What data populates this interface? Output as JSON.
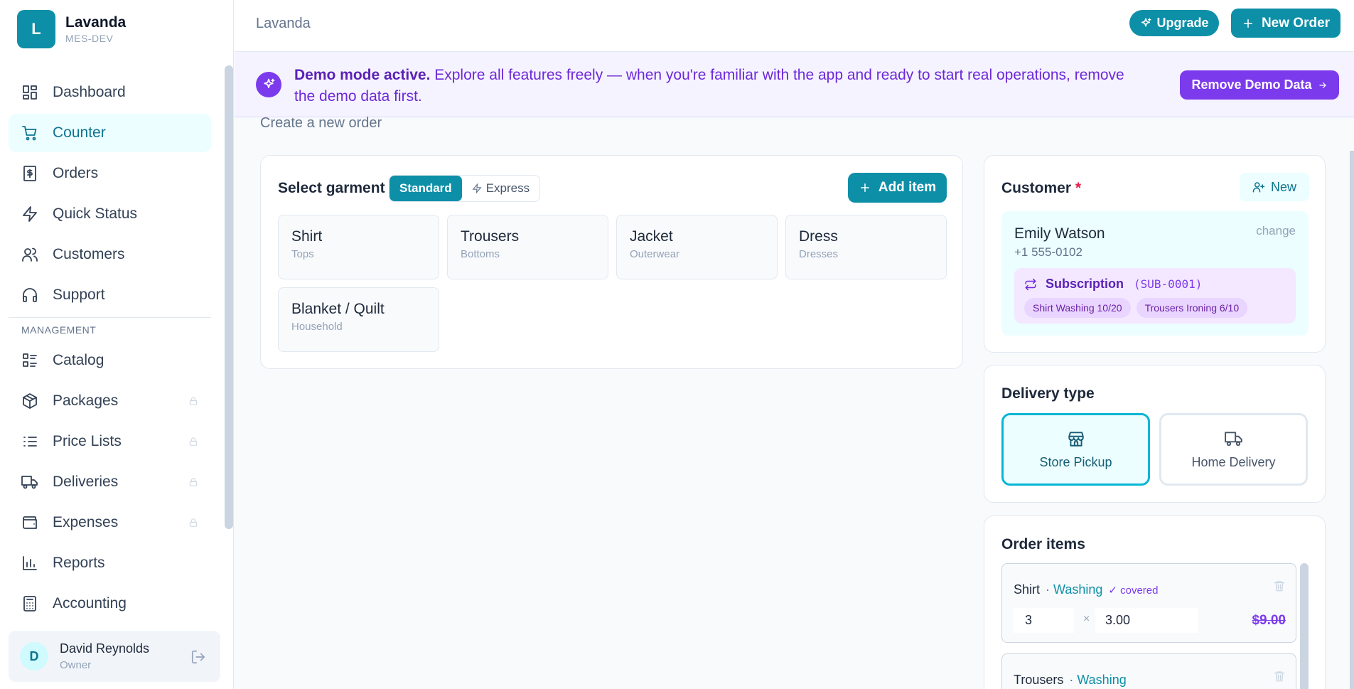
{
  "brand": {
    "initial": "L",
    "name": "Lavanda",
    "sub": "MES-DEV"
  },
  "nav": {
    "items": [
      {
        "label": "Dashboard"
      },
      {
        "label": "Counter"
      },
      {
        "label": "Orders"
      },
      {
        "label": "Quick Status"
      },
      {
        "label": "Customers"
      },
      {
        "label": "Support"
      }
    ],
    "section_label": "MANAGEMENT",
    "mgmt_items": [
      {
        "label": "Catalog"
      },
      {
        "label": "Packages"
      },
      {
        "label": "Price Lists"
      },
      {
        "label": "Deliveries"
      },
      {
        "label": "Expenses"
      },
      {
        "label": "Reports"
      },
      {
        "label": "Accounting"
      }
    ]
  },
  "user": {
    "initial": "D",
    "name": "David Reynolds",
    "role": "Owner"
  },
  "topbar": {
    "title": "Lavanda",
    "upgrade_label": "Upgrade",
    "new_order_label": "New Order"
  },
  "banner": {
    "bold": "Demo mode active.",
    "text": " Explore all features freely — when you're familiar with the app and ready to start real operations, remove the demo data first.",
    "button_label": "Remove Demo Data"
  },
  "page": {
    "subtitle": "Create a new order"
  },
  "garments": {
    "title": "Select garment",
    "mode_standard": "Standard",
    "mode_express": "Express",
    "add_label": "Add item",
    "items": [
      {
        "name": "Shirt",
        "category": "Tops"
      },
      {
        "name": "Trousers",
        "category": "Bottoms"
      },
      {
        "name": "Jacket",
        "category": "Outerwear"
      },
      {
        "name": "Dress",
        "category": "Dresses"
      },
      {
        "name": "Blanket / Quilt",
        "category": "Household"
      }
    ]
  },
  "customer": {
    "title": "Customer",
    "required_mark": "*",
    "new_label": "New",
    "name": "Emily Watson",
    "phone": "+1 555-0102",
    "change_label": "change",
    "subscription": {
      "title": "Subscription",
      "code": "(SUB-0001)",
      "chips": [
        "Shirt Washing 10/20",
        "Trousers Ironing 6/10"
      ]
    }
  },
  "delivery": {
    "title": "Delivery type",
    "options": [
      {
        "label": "Store Pickup"
      },
      {
        "label": "Home Delivery"
      }
    ],
    "selected": "Store Pickup"
  },
  "order_items": {
    "title": "Order items",
    "items": [
      {
        "name": "Shirt",
        "service": "· Washing",
        "covered": "✓ covered",
        "qty": "3",
        "times": "×",
        "price": "3.00",
        "total": "$9.00"
      },
      {
        "name": "Trousers",
        "service": "· Washing"
      }
    ]
  },
  "colors": {
    "accent": "#0e8fa8",
    "demo": "#7c3aed",
    "active_bg": "#ecfeff"
  }
}
